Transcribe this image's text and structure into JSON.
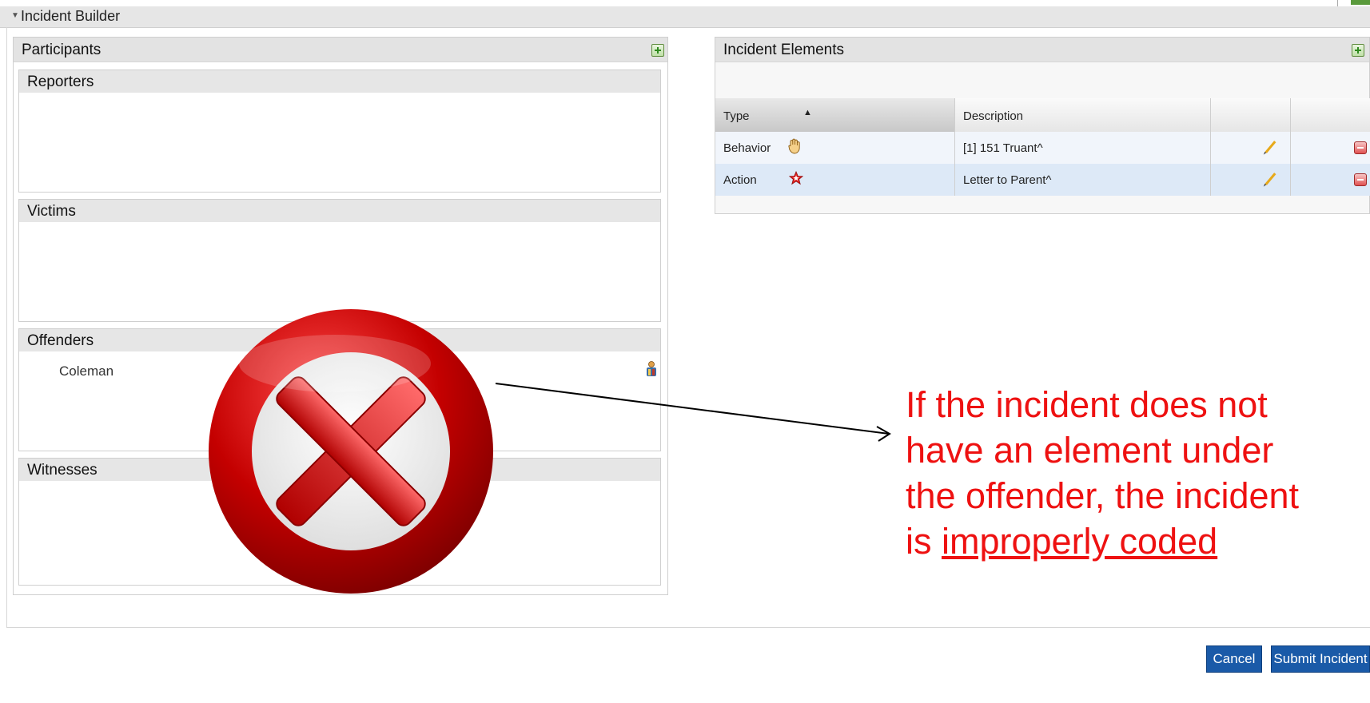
{
  "header": {
    "collapse_glyph": "▼",
    "title": "Incident Builder"
  },
  "participants": {
    "title": "Participants",
    "add_icon": "add-icon",
    "sections": {
      "reporters": {
        "title": "Reporters"
      },
      "victims": {
        "title": "Victims"
      },
      "offenders": {
        "title": "Offenders",
        "names": [
          "Coleman"
        ],
        "person_icon": "student-icon"
      },
      "witnesses": {
        "title": "Witnesses"
      }
    }
  },
  "elements": {
    "title": "Incident Elements",
    "add_icon": "add-icon",
    "columns": [
      "Type",
      "Description",
      "",
      ""
    ],
    "sort_glyph": "▲",
    "rows": [
      {
        "type": "Behavior",
        "icon": "hand-icon",
        "description": "[1] 151 Truant^"
      },
      {
        "type": "Action",
        "icon": "star-icon",
        "description": "Letter to Parent^"
      }
    ]
  },
  "overlay": {
    "icon": "error-x-icon"
  },
  "annotation": {
    "lines": [
      "If the incident does not",
      "have an element under",
      "the offender, the incident"
    ],
    "last_prefix": "is ",
    "last_underlined": "improperly coded",
    "color": "#ee1111"
  },
  "buttons": {
    "cancel": "Cancel",
    "submit": "Submit Incident"
  },
  "colors": {
    "button": "#1a5aa8",
    "selected_row": "#dde9f7",
    "header": "#e6e6e6"
  }
}
